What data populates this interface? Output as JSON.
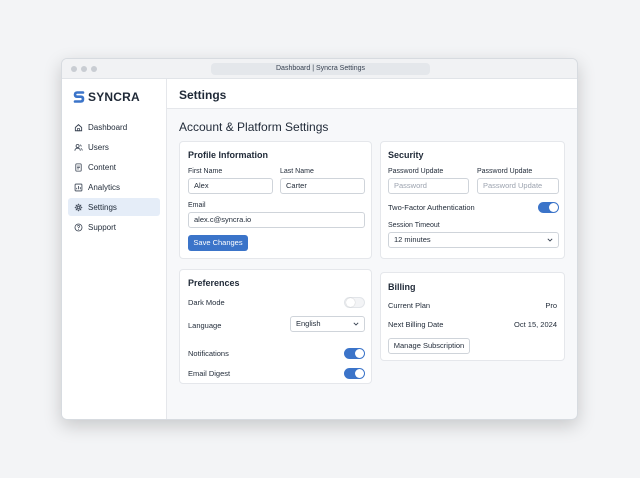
{
  "window": {
    "address_title": "Dashboard | Syncra Settings"
  },
  "brand": {
    "name": "SYNCRA",
    "accent": "#3b74c9"
  },
  "sidebar": {
    "items": [
      {
        "label": "Dashboard",
        "icon": "home-icon",
        "active": false
      },
      {
        "label": "Users",
        "icon": "users-icon",
        "active": false
      },
      {
        "label": "Content",
        "icon": "document-icon",
        "active": false
      },
      {
        "label": "Analytics",
        "icon": "chart-icon",
        "active": false
      },
      {
        "label": "Settings",
        "icon": "gear-icon",
        "active": true
      },
      {
        "label": "Support",
        "icon": "help-icon",
        "active": false
      }
    ]
  },
  "header": {
    "title": "Settings"
  },
  "main": {
    "heading": "Account & Platform Settings"
  },
  "profile": {
    "title": "Profile Information",
    "first_name_label": "First Name",
    "first_name_value": "Alex",
    "last_name_label": "Last Name",
    "last_name_value": "Carter",
    "email_label": "Email",
    "email_value": "alex.c@syncra.io",
    "save_label": "Save Changes"
  },
  "security": {
    "title": "Security",
    "password_label_1": "Password Update",
    "password_placeholder_1": "Password",
    "password_label_2": "Password Update",
    "password_placeholder_2": "Password Update",
    "two_factor_label": "Two-Factor Authentication",
    "two_factor_on": true,
    "session_timeout_label": "Session Timeout",
    "session_timeout_value": "12 minutes"
  },
  "preferences": {
    "title": "Preferences",
    "dark_mode_label": "Dark Mode",
    "dark_mode_on": false,
    "language_label": "Language",
    "language_value": "English",
    "notifications_label": "Notifications",
    "notifications_on": true,
    "email_digest_label": "Email Digest",
    "email_digest_on": true
  },
  "billing": {
    "title": "Billing",
    "plan_label": "Current Plan",
    "plan_value": "Pro",
    "next_billing_label": "Next Billing Date",
    "next_billing_value": "Oct 15, 2024",
    "manage_label": "Manage Subscription"
  }
}
